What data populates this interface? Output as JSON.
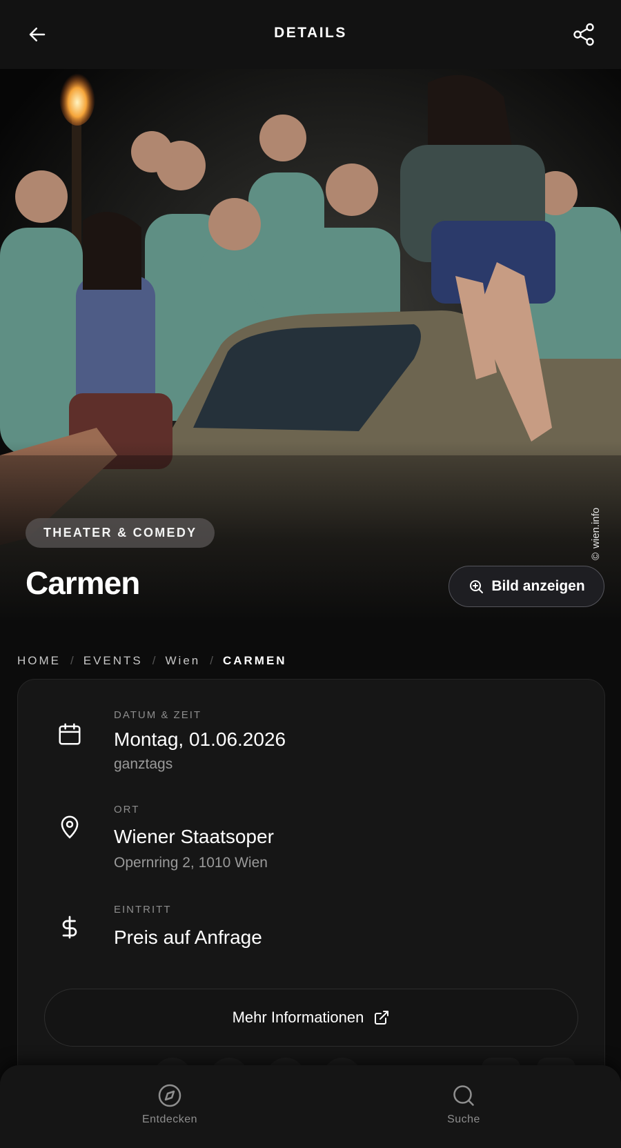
{
  "header": {
    "title": "DETAILS",
    "back_icon": "arrow-left-icon",
    "share_icon": "share-icon"
  },
  "hero": {
    "category": "THEATER & COMEDY",
    "title": "Carmen",
    "credit": "wien.info",
    "show_image_label": "Bild anzeigen"
  },
  "breadcrumb": {
    "items": [
      "HOME",
      "EVENTS",
      "Wien"
    ],
    "current": "CARMEN",
    "separator": "/"
  },
  "details": {
    "date": {
      "label": "DATUM & ZEIT",
      "value": "Montag, 01.06.2026",
      "sub": "ganztags"
    },
    "location": {
      "label": "ORT",
      "value": "Wiener Staatsoper",
      "sub": "Opernring 2, 1010 Wien"
    },
    "admission": {
      "label": "EINTRITT",
      "value": "Preis auf Anfrage"
    },
    "more_info_label": "Mehr Informationen"
  },
  "bottom_nav": {
    "items": [
      {
        "label": "Entdecken",
        "icon": "compass-icon"
      },
      {
        "label": "Suche",
        "icon": "search-icon"
      }
    ]
  },
  "colors": {
    "background": "#0c0c0c",
    "card": "#161616",
    "muted_text": "#8d8d8d"
  }
}
